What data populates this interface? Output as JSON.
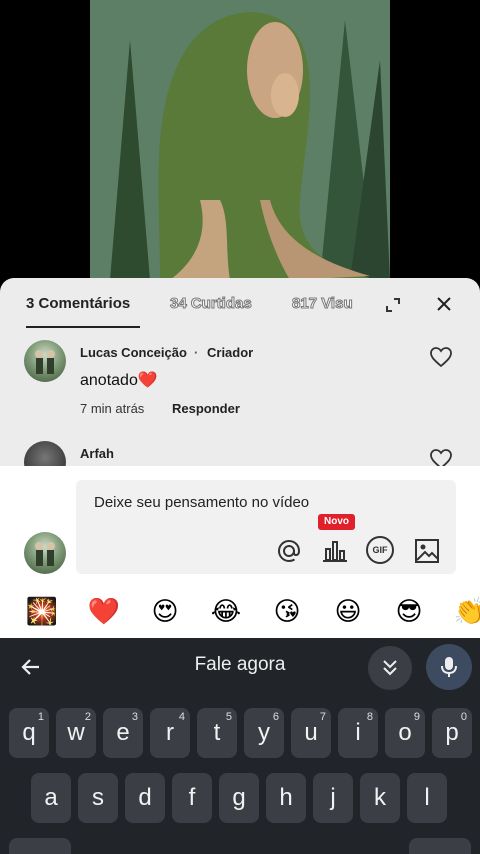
{
  "comments_sheet": {
    "tabs": [
      {
        "label": "3 Comentários"
      },
      {
        "label": "34 Curtidas"
      },
      {
        "label": "817 Visu"
      }
    ],
    "comments": [
      {
        "author": "Lucas Conceição",
        "badge": "Criador",
        "text": "anotado❤️",
        "time": "7 min atrás",
        "reply": "Responder"
      },
      {
        "author": "Arfah"
      }
    ]
  },
  "composer": {
    "placeholder": "Deixe seu pensamento no vídeo",
    "new_badge": "Novo",
    "gif_label": "GIF",
    "emojis": [
      "🎇",
      "❤️",
      "😍",
      "😂",
      "😘",
      "😃",
      "😎",
      "👏"
    ]
  },
  "keyboard": {
    "voice_label": "Fale agora",
    "row1": [
      {
        "key": "q",
        "num": "1"
      },
      {
        "key": "w",
        "num": "2"
      },
      {
        "key": "e",
        "num": "3"
      },
      {
        "key": "r",
        "num": "4"
      },
      {
        "key": "t",
        "num": "5"
      },
      {
        "key": "y",
        "num": "6"
      },
      {
        "key": "u",
        "num": "7"
      },
      {
        "key": "i",
        "num": "8"
      },
      {
        "key": "o",
        "num": "9"
      },
      {
        "key": "p",
        "num": "0"
      }
    ],
    "row2": [
      "a",
      "s",
      "d",
      "f",
      "g",
      "h",
      "j",
      "k",
      "l"
    ]
  },
  "colors": {
    "sheet_bg": "#ececec",
    "keyboard_bg": "#212529",
    "key_bg": "#3b3f45",
    "accent_red": "#e0212b"
  }
}
